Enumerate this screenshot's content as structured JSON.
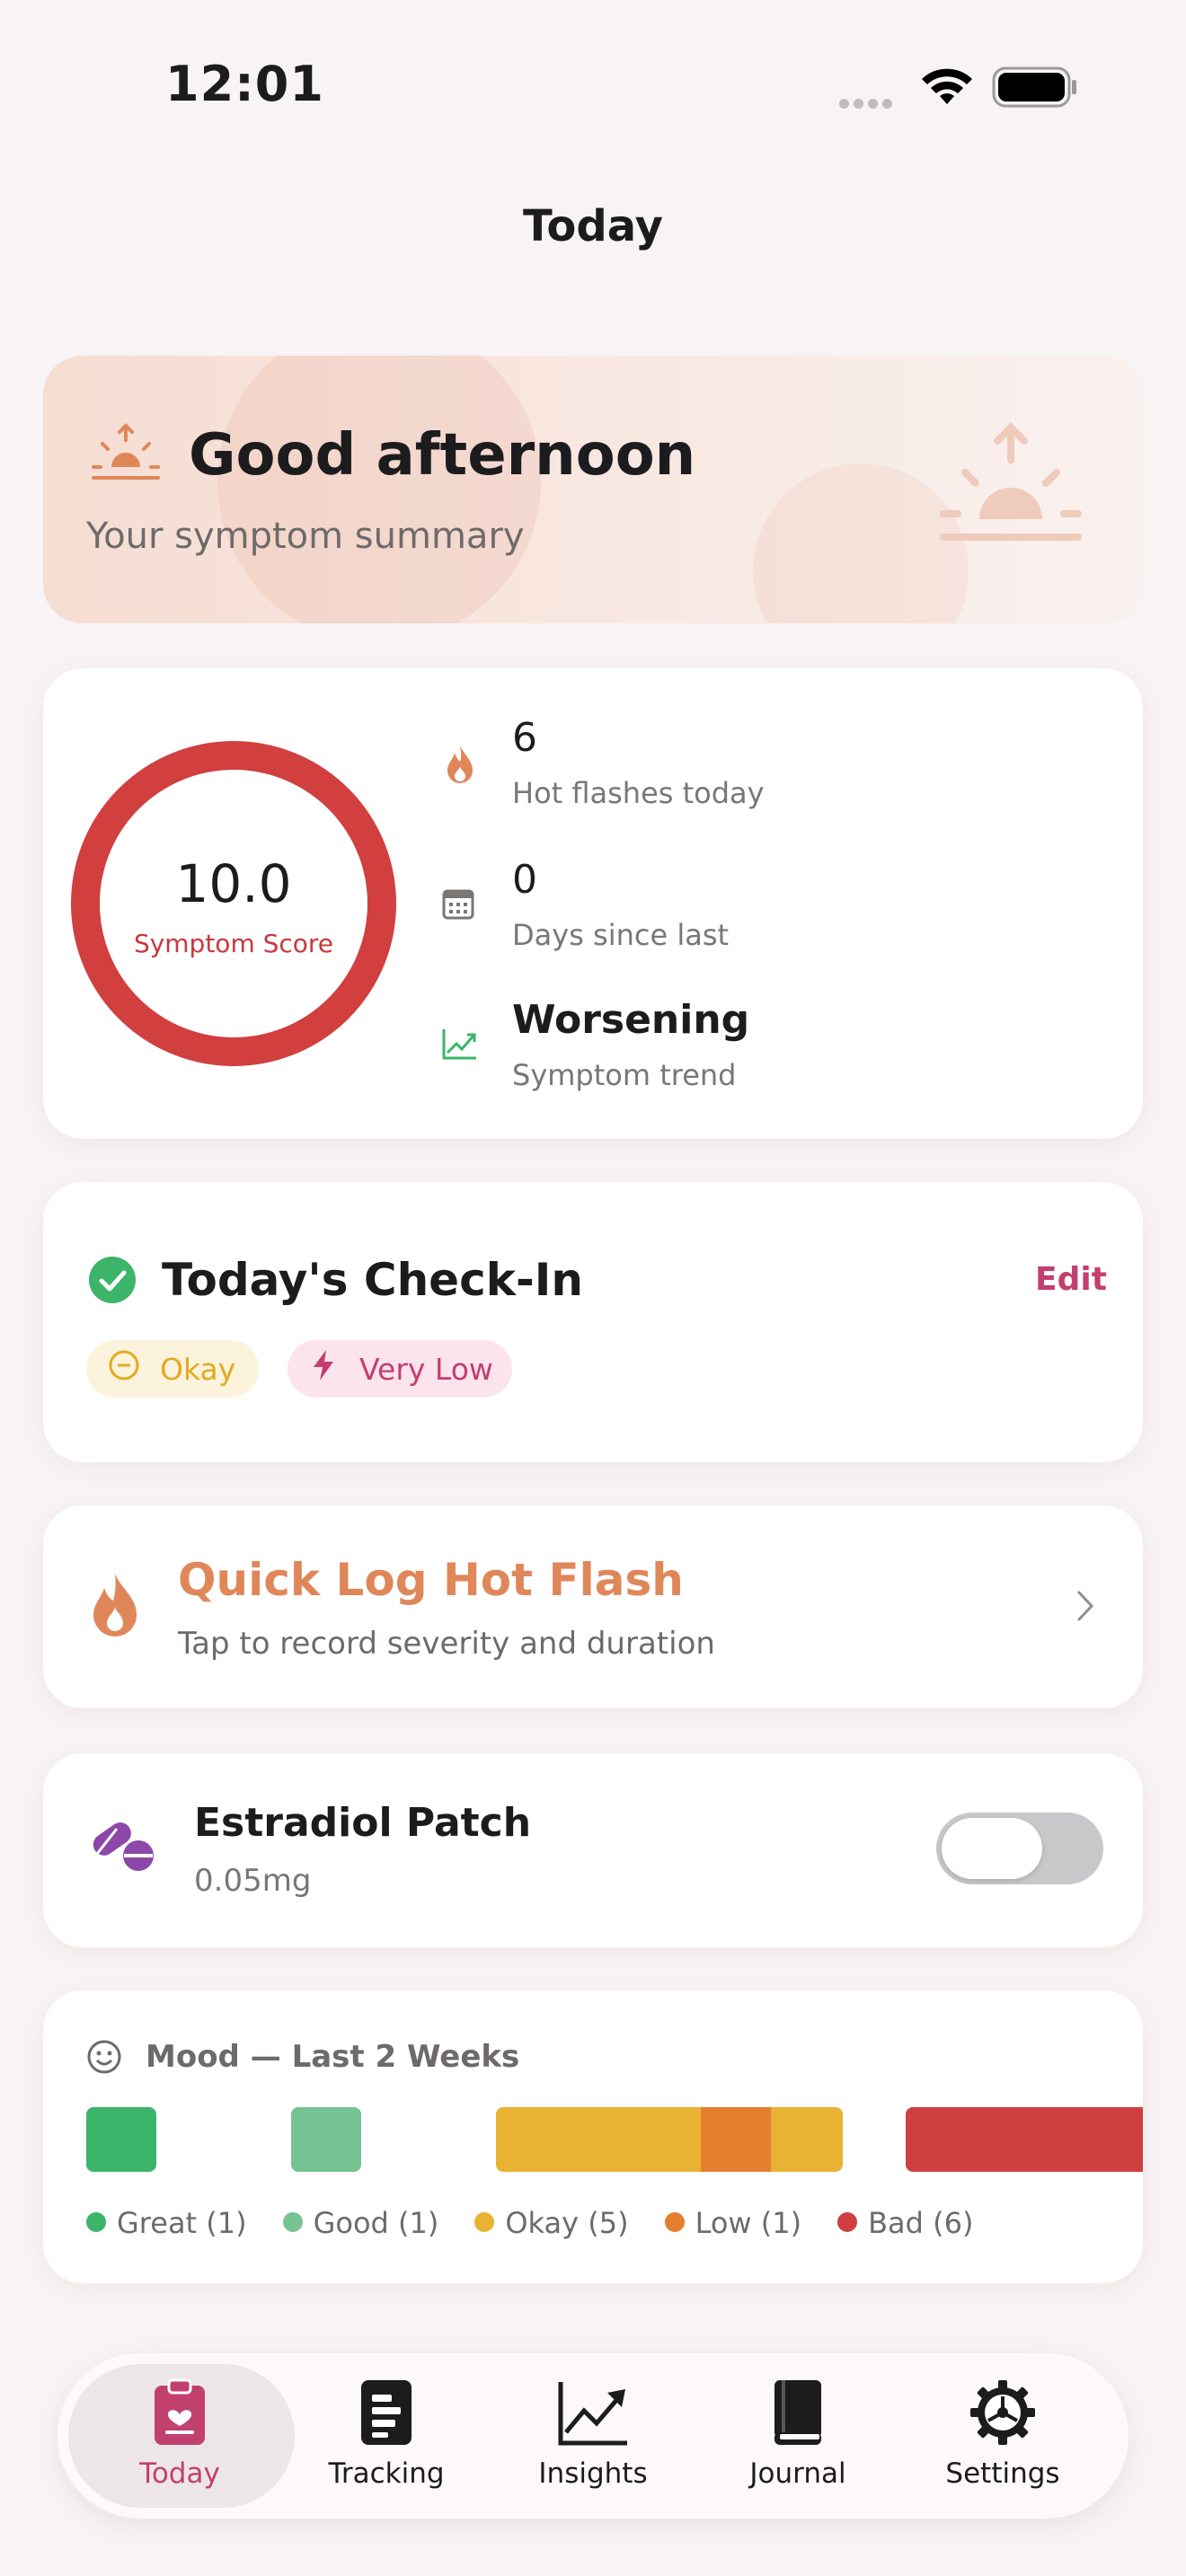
{
  "status_bar": {
    "time": "12:01"
  },
  "nav": {
    "title": "Today"
  },
  "greeting": {
    "title": "Good afternoon",
    "subtitle": "Your symptom summary"
  },
  "score": {
    "value": "10.0",
    "label": "Symptom Score",
    "ring_color": "#d13f3f",
    "stats": [
      {
        "icon": "flame-icon",
        "value": "6",
        "label": "Hot flashes today"
      },
      {
        "icon": "calendar-icon",
        "value": "0",
        "label": "Days since last"
      },
      {
        "icon": "trend-chart-icon",
        "value": "Worsening",
        "label": "Symptom trend"
      }
    ]
  },
  "checkin": {
    "title": "Today's Check-In",
    "edit_label": "Edit",
    "mood_chip": "Okay",
    "energy_chip": "Very Low"
  },
  "quick_log": {
    "title": "Quick Log Hot Flash",
    "subtitle": "Tap to record severity and duration"
  },
  "medication": {
    "name": "Estradiol Patch",
    "dose": "0.05mg",
    "enabled": false
  },
  "mood": {
    "title": "Mood — Last 2 Weeks",
    "legend": [
      {
        "label": "Great (1)",
        "color": "#3cb56a"
      },
      {
        "label": "Good (1)",
        "color": "#77c293"
      },
      {
        "label": "Okay (5)",
        "color": "#e8b232"
      },
      {
        "label": "Low (1)",
        "color": "#e67e2f"
      },
      {
        "label": "Bad (6)",
        "color": "#cf3f3f"
      }
    ]
  },
  "tabs": [
    {
      "label": "Today",
      "icon": "clipboard-heart-icon",
      "active": true
    },
    {
      "label": "Tracking",
      "icon": "list-icon",
      "active": false
    },
    {
      "label": "Insights",
      "icon": "chart-up-icon",
      "active": false
    },
    {
      "label": "Journal",
      "icon": "book-icon",
      "active": false
    },
    {
      "label": "Settings",
      "icon": "gear-icon",
      "active": false
    }
  ],
  "colors": {
    "accent": "#c2406e",
    "flame": "#e0875a",
    "success": "#3cb56a"
  }
}
